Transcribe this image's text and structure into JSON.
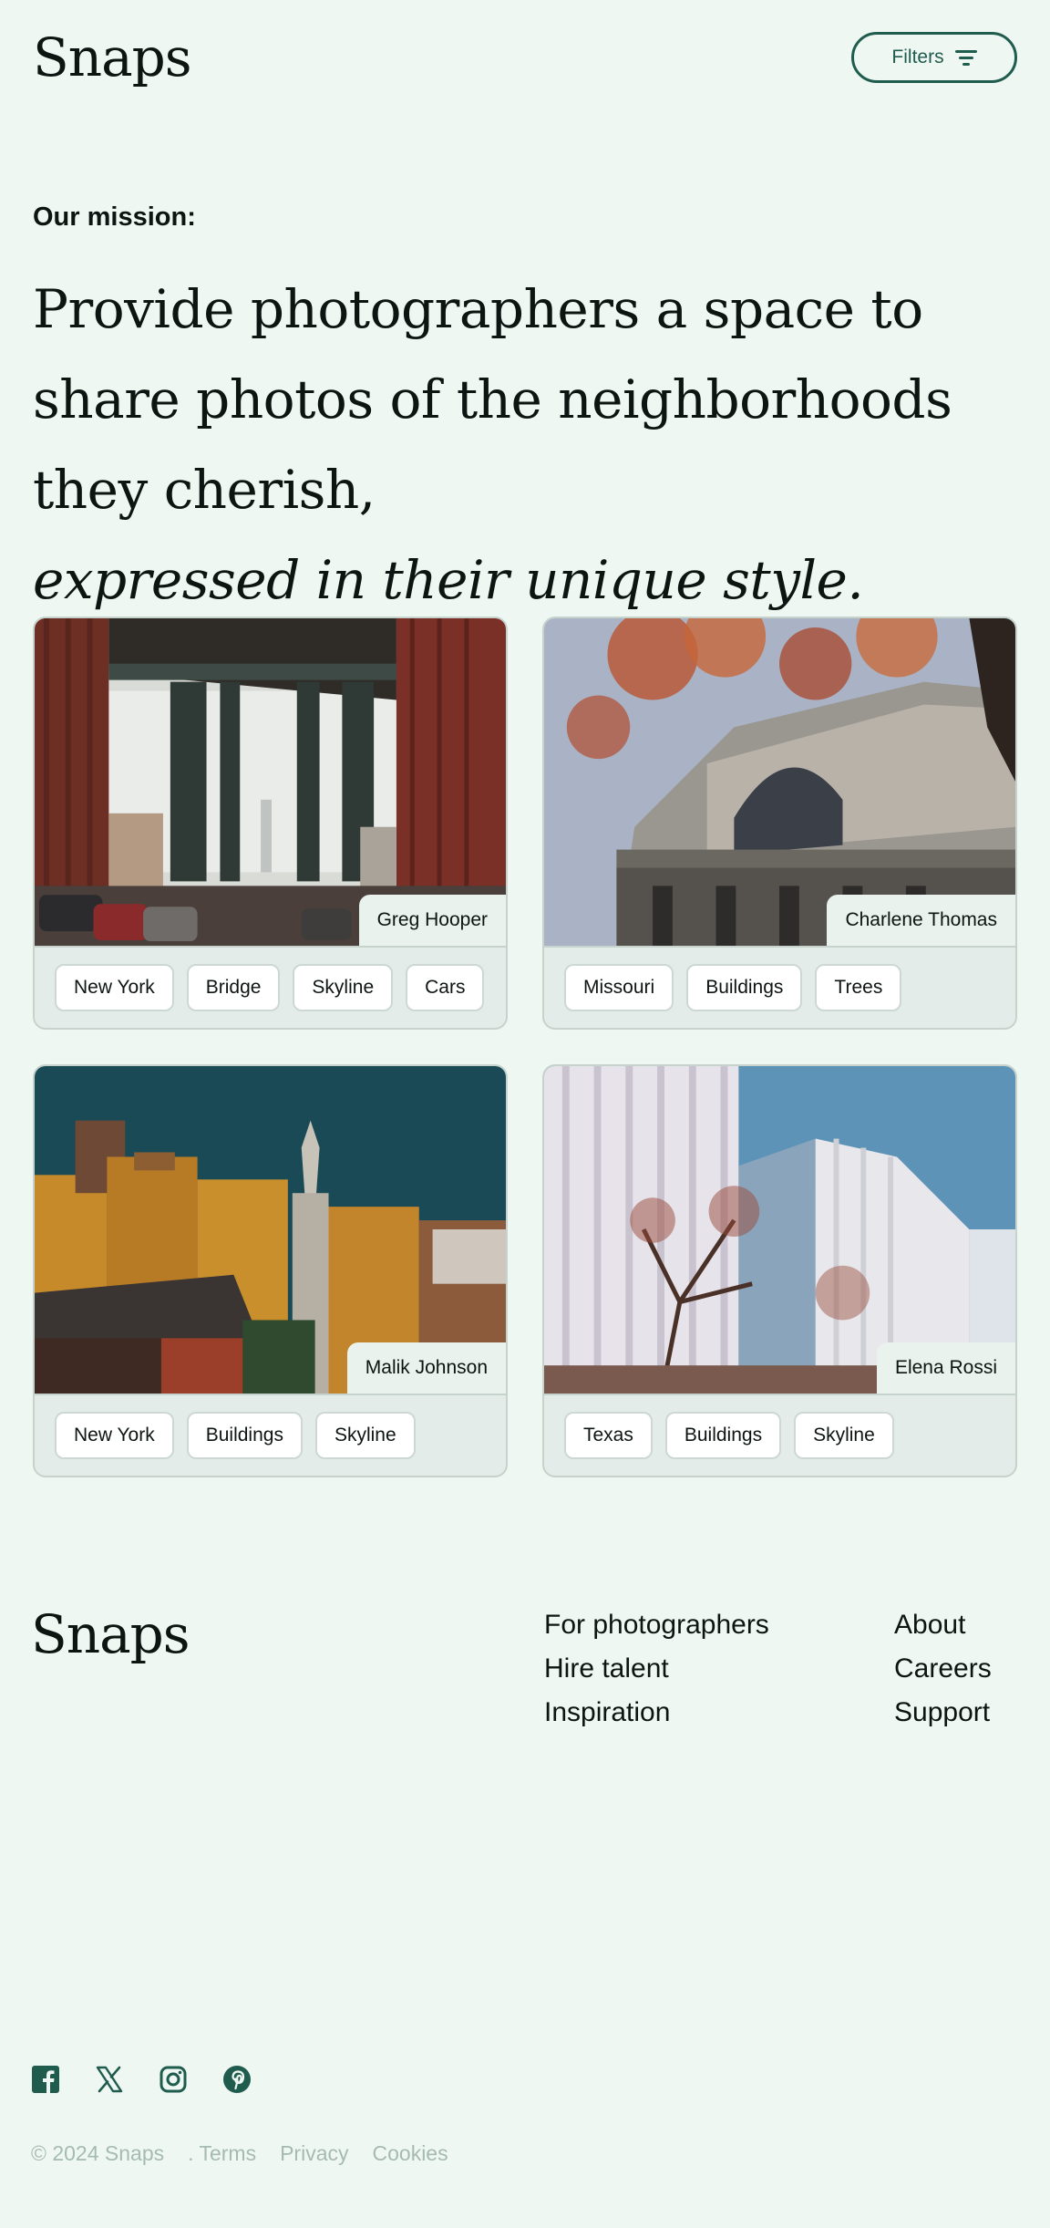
{
  "header": {
    "logo": "Snaps",
    "filters_label": "Filters"
  },
  "mission": {
    "label": "Our mission:",
    "text": "Provide photographers a space to share photos of the neighborhoods they cherish,",
    "italic": "expressed in their unique style."
  },
  "cards": [
    {
      "photographer": "Greg Hooper",
      "tags": [
        "New York",
        "Bridge",
        "Skyline",
        "Cars"
      ]
    },
    {
      "photographer": "Charlene Thomas",
      "tags": [
        "Missouri",
        "Buildings",
        "Trees"
      ]
    },
    {
      "photographer": "Malik Johnson",
      "tags": [
        "New York",
        "Buildings",
        "Skyline"
      ]
    },
    {
      "photographer": "Elena Rossi",
      "tags": [
        "Texas",
        "Buildings",
        "Skyline"
      ]
    }
  ],
  "footer": {
    "logo": "Snaps",
    "links_col1": [
      "For photographers",
      "Hire talent",
      "Inspiration"
    ],
    "links_col2": [
      "About",
      "Careers",
      "Support"
    ],
    "socials": [
      "facebook-icon",
      "x-icon",
      "instagram-icon",
      "pinterest-icon"
    ],
    "copyright": "© 2024 Snaps",
    "legal": [
      ". Terms",
      "Privacy",
      "Cookies"
    ]
  },
  "colors": {
    "background": "#eff7f3",
    "accent": "#1f5c4d",
    "muted_text": "#a5bbb2"
  }
}
